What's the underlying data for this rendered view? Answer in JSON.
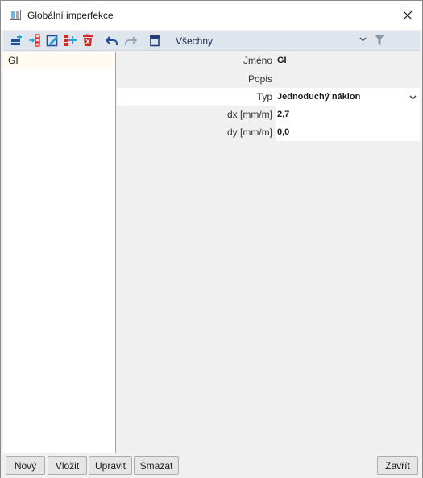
{
  "window": {
    "title": "Globální imperfekce"
  },
  "toolbar": {
    "filter_value": "Všechny",
    "icons": [
      "new-row-icon",
      "insert-icon",
      "edit-icon",
      "copy-icon",
      "delete-icon",
      "undo-icon",
      "redo-icon",
      "table-icon",
      "chevron-down-icon",
      "filter-icon"
    ]
  },
  "list": {
    "items": [
      "GI"
    ]
  },
  "properties": {
    "rows": [
      {
        "label": "Jméno",
        "value": "GI"
      },
      {
        "label": "Popis",
        "value": ""
      },
      {
        "label": "Typ",
        "value": "Jednoduchý náklon"
      },
      {
        "label": "dx [mm/m]",
        "value": "2,7"
      },
      {
        "label": "dy [mm/m]",
        "value": "0,0"
      }
    ]
  },
  "buttons": {
    "new": "Nový",
    "insert": "Vložit",
    "edit": "Upravit",
    "delete": "Smazat",
    "close": "Zavřít"
  },
  "colors": {
    "accent_blue": "#1f4e9a",
    "accent_red": "#d42a2a",
    "accent_cyan": "#2aa0d8"
  }
}
